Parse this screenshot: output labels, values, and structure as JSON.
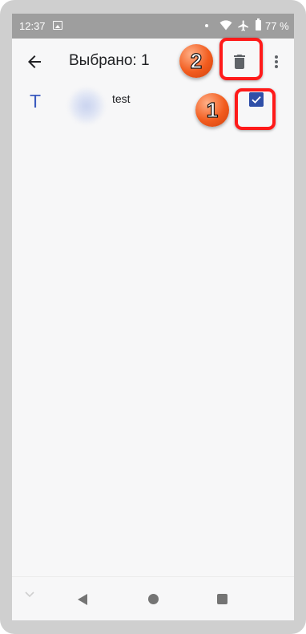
{
  "status_bar": {
    "time": "12:37",
    "battery_percent": "77 %",
    "icons": [
      "image-icon",
      "dot-icon",
      "wifi-icon",
      "airplane-icon",
      "battery-icon"
    ]
  },
  "app_bar": {
    "title": "Выбрано: 1",
    "icons": [
      "back-arrow-icon",
      "trash-icon",
      "more-vert-icon"
    ]
  },
  "list": {
    "items": [
      {
        "letter": "T",
        "name": "test",
        "checked": true
      }
    ]
  },
  "annotations": {
    "badge_1": "1",
    "badge_2": "2",
    "ring_color": "#ff1a1a",
    "badge_color": "#f25c1e"
  },
  "nav_bar": {
    "icons": [
      "chevron-down-icon",
      "nav-back-icon",
      "nav-home-icon",
      "nav-recents-icon"
    ]
  },
  "colors": {
    "accent": "#2f4fa8",
    "letter": "#3b5bbf",
    "status_bar": "#9e9e9e"
  }
}
